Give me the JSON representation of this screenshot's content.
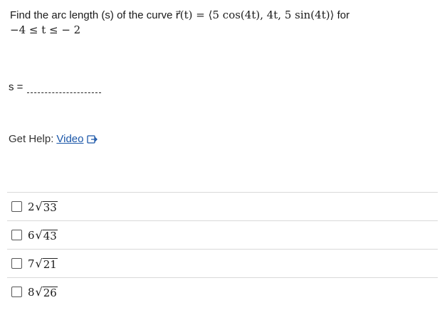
{
  "question": {
    "line1_text": "Find the arc length (s) of the curve ",
    "line1_math": "r⃗(t) = ⟨5 cos(4t), 4t, 5 sin(4t)⟩",
    "line1_suffix": " for",
    "line2_math": "−4 ≤ t ≤  − 2"
  },
  "answer": {
    "label": "s ="
  },
  "help": {
    "label": "Get Help:",
    "link": "Video",
    "icon": "external-video-icon"
  },
  "choices": [
    {
      "coef": "2",
      "radicand": "33"
    },
    {
      "coef": "6",
      "radicand": "43"
    },
    {
      "coef": "7",
      "radicand": "21"
    },
    {
      "coef": "8",
      "radicand": "26"
    }
  ],
  "colors": {
    "link": "#1a56a8",
    "divider": "#d9d9d9"
  }
}
